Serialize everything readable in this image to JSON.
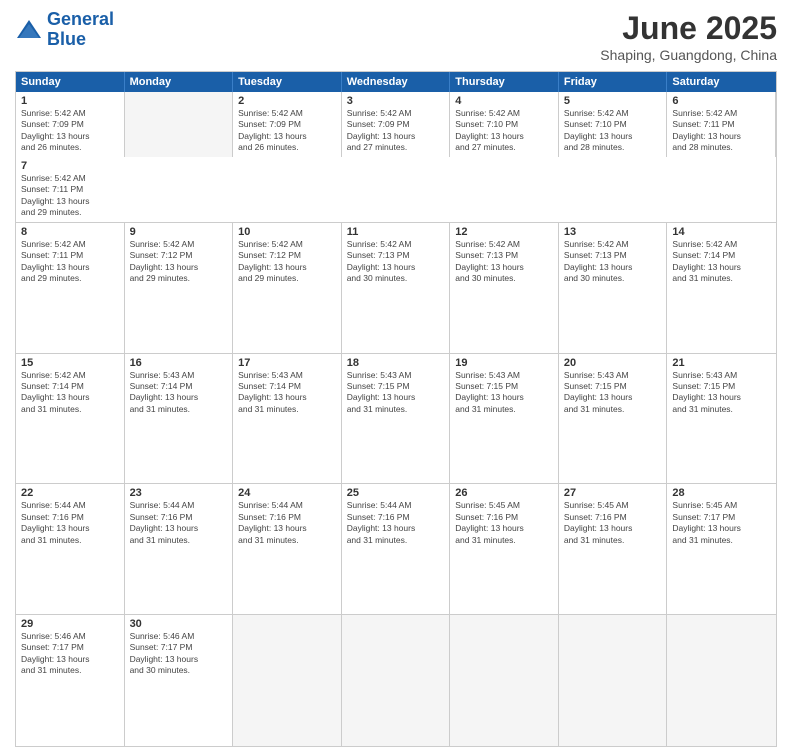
{
  "header": {
    "logo_line1": "General",
    "logo_line2": "Blue",
    "month": "June 2025",
    "location": "Shaping, Guangdong, China"
  },
  "weekdays": [
    "Sunday",
    "Monday",
    "Tuesday",
    "Wednesday",
    "Thursday",
    "Friday",
    "Saturday"
  ],
  "rows": [
    [
      {
        "day": "",
        "text": ""
      },
      {
        "day": "2",
        "text": "Sunrise: 5:42 AM\nSunset: 7:09 PM\nDaylight: 13 hours\nand 26 minutes."
      },
      {
        "day": "3",
        "text": "Sunrise: 5:42 AM\nSunset: 7:09 PM\nDaylight: 13 hours\nand 27 minutes."
      },
      {
        "day": "4",
        "text": "Sunrise: 5:42 AM\nSunset: 7:10 PM\nDaylight: 13 hours\nand 27 minutes."
      },
      {
        "day": "5",
        "text": "Sunrise: 5:42 AM\nSunset: 7:10 PM\nDaylight: 13 hours\nand 28 minutes."
      },
      {
        "day": "6",
        "text": "Sunrise: 5:42 AM\nSunset: 7:11 PM\nDaylight: 13 hours\nand 28 minutes."
      },
      {
        "day": "7",
        "text": "Sunrise: 5:42 AM\nSunset: 7:11 PM\nDaylight: 13 hours\nand 29 minutes."
      }
    ],
    [
      {
        "day": "8",
        "text": "Sunrise: 5:42 AM\nSunset: 7:11 PM\nDaylight: 13 hours\nand 29 minutes."
      },
      {
        "day": "9",
        "text": "Sunrise: 5:42 AM\nSunset: 7:12 PM\nDaylight: 13 hours\nand 29 minutes."
      },
      {
        "day": "10",
        "text": "Sunrise: 5:42 AM\nSunset: 7:12 PM\nDaylight: 13 hours\nand 29 minutes."
      },
      {
        "day": "11",
        "text": "Sunrise: 5:42 AM\nSunset: 7:13 PM\nDaylight: 13 hours\nand 30 minutes."
      },
      {
        "day": "12",
        "text": "Sunrise: 5:42 AM\nSunset: 7:13 PM\nDaylight: 13 hours\nand 30 minutes."
      },
      {
        "day": "13",
        "text": "Sunrise: 5:42 AM\nSunset: 7:13 PM\nDaylight: 13 hours\nand 30 minutes."
      },
      {
        "day": "14",
        "text": "Sunrise: 5:42 AM\nSunset: 7:14 PM\nDaylight: 13 hours\nand 31 minutes."
      }
    ],
    [
      {
        "day": "15",
        "text": "Sunrise: 5:42 AM\nSunset: 7:14 PM\nDaylight: 13 hours\nand 31 minutes."
      },
      {
        "day": "16",
        "text": "Sunrise: 5:43 AM\nSunset: 7:14 PM\nDaylight: 13 hours\nand 31 minutes."
      },
      {
        "day": "17",
        "text": "Sunrise: 5:43 AM\nSunset: 7:14 PM\nDaylight: 13 hours\nand 31 minutes."
      },
      {
        "day": "18",
        "text": "Sunrise: 5:43 AM\nSunset: 7:15 PM\nDaylight: 13 hours\nand 31 minutes."
      },
      {
        "day": "19",
        "text": "Sunrise: 5:43 AM\nSunset: 7:15 PM\nDaylight: 13 hours\nand 31 minutes."
      },
      {
        "day": "20",
        "text": "Sunrise: 5:43 AM\nSunset: 7:15 PM\nDaylight: 13 hours\nand 31 minutes."
      },
      {
        "day": "21",
        "text": "Sunrise: 5:43 AM\nSunset: 7:15 PM\nDaylight: 13 hours\nand 31 minutes."
      }
    ],
    [
      {
        "day": "22",
        "text": "Sunrise: 5:44 AM\nSunset: 7:16 PM\nDaylight: 13 hours\nand 31 minutes."
      },
      {
        "day": "23",
        "text": "Sunrise: 5:44 AM\nSunset: 7:16 PM\nDaylight: 13 hours\nand 31 minutes."
      },
      {
        "day": "24",
        "text": "Sunrise: 5:44 AM\nSunset: 7:16 PM\nDaylight: 13 hours\nand 31 minutes."
      },
      {
        "day": "25",
        "text": "Sunrise: 5:44 AM\nSunset: 7:16 PM\nDaylight: 13 hours\nand 31 minutes."
      },
      {
        "day": "26",
        "text": "Sunrise: 5:45 AM\nSunset: 7:16 PM\nDaylight: 13 hours\nand 31 minutes."
      },
      {
        "day": "27",
        "text": "Sunrise: 5:45 AM\nSunset: 7:16 PM\nDaylight: 13 hours\nand 31 minutes."
      },
      {
        "day": "28",
        "text": "Sunrise: 5:45 AM\nSunset: 7:17 PM\nDaylight: 13 hours\nand 31 minutes."
      }
    ],
    [
      {
        "day": "29",
        "text": "Sunrise: 5:46 AM\nSunset: 7:17 PM\nDaylight: 13 hours\nand 31 minutes."
      },
      {
        "day": "30",
        "text": "Sunrise: 5:46 AM\nSunset: 7:17 PM\nDaylight: 13 hours\nand 30 minutes."
      },
      {
        "day": "",
        "text": ""
      },
      {
        "day": "",
        "text": ""
      },
      {
        "day": "",
        "text": ""
      },
      {
        "day": "",
        "text": ""
      },
      {
        "day": "",
        "text": ""
      }
    ]
  ],
  "first_day_text": "1",
  "first_day_info": "Sunrise: 5:42 AM\nSunset: 7:09 PM\nDaylight: 13 hours\nand 26 minutes."
}
